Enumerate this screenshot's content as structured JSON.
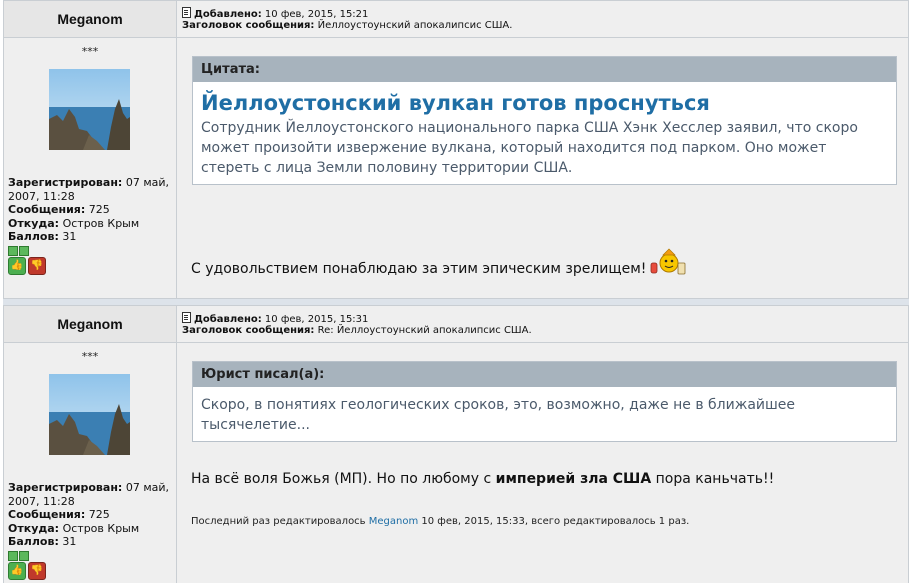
{
  "posts": [
    {
      "author": "Meganom",
      "rank": "***",
      "registered_label": "Зарегистрирован:",
      "registered_value": "07 май, 2007, 11:28",
      "messages_label": "Сообщения:",
      "messages_value": "725",
      "location_label": "Откуда:",
      "location_value": "Остров Крым",
      "points_label": "Баллов:",
      "points_value": "31",
      "added_label": "Добавлено:",
      "added_value": "10 фев, 2015, 15:21",
      "subject_label": "Заголовок сообщения:",
      "subject_value": "Йеллоустоунский апокалипсис США.",
      "quote_label": "Цитата:",
      "quote_title": "Йеллоустонский вулкан готов проснуться",
      "quote_body": "Сотрудник Йеллоустонского национального парка США Хэнк Хесслер заявил, что скоро может произойти извержение вулкана, который находится под парком. Оно может стереть с лица Земли половину территории США.",
      "message": "С удовольствием понаблюдаю за этим эпическим зрелищем!"
    },
    {
      "author": "Meganom",
      "rank": "***",
      "registered_label": "Зарегистрирован:",
      "registered_value": "07 май, 2007, 11:28",
      "messages_label": "Сообщения:",
      "messages_value": "725",
      "location_label": "Откуда:",
      "location_value": "Остров Крым",
      "points_label": "Баллов:",
      "points_value": "31",
      "added_label": "Добавлено:",
      "added_value": "10 фев, 2015, 15:31",
      "subject_label": "Заголовок сообщения:",
      "subject_value": "Re: Йеллоустоунский апокалипсис США.",
      "quote_label": "Юрист писал(а):",
      "quote_body": "Скоро, в понятиях геологических сроков, это, возможно, даже не в ближайшее тысячелетие...",
      "message_pre": "На всё воля Божья (МП). Но по любому с ",
      "message_bold": "империей зла США",
      "message_post": " пора каньчать!!",
      "edited_pre": "Последний раз редактировалось ",
      "edited_user": "Meganom",
      "edited_post": " 10 фев, 2015, 15:33, всего редактировалось 1 раз."
    }
  ],
  "colors": {
    "quote_title": "#1f6ea5",
    "quote_header": "#a7b3bd",
    "vote_up": "#4caf50",
    "vote_down": "#c0392b"
  },
  "icons": [
    "post-icon",
    "avatar-image",
    "rep-square-icon",
    "thumbs-up-icon",
    "thumbs-down-icon",
    "smiley-icon"
  ]
}
